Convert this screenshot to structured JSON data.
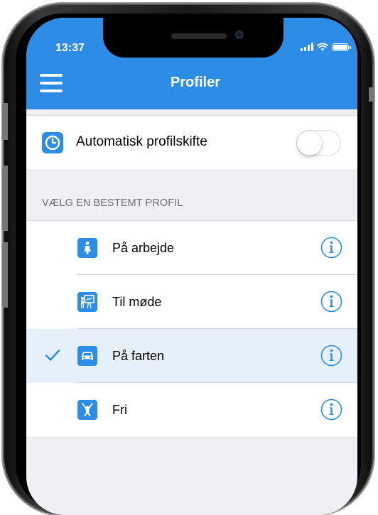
{
  "status_bar": {
    "time": "13:37"
  },
  "header": {
    "title": "Profiler",
    "menu_icon": "hamburger-menu-icon"
  },
  "auto_switch": {
    "label": "Automatisk profilskifte",
    "icon": "clock-icon",
    "enabled": false
  },
  "section": {
    "title": "VÆLG EN BESTEMT PROFIL"
  },
  "profiles": [
    {
      "label": "På arbejde",
      "icon": "worker-icon",
      "selected": false
    },
    {
      "label": "Til møde",
      "icon": "presentation-icon",
      "selected": false
    },
    {
      "label": "På farten",
      "icon": "car-icon",
      "selected": true
    },
    {
      "label": "Fri",
      "icon": "jumping-person-icon",
      "selected": false
    }
  ],
  "colors": {
    "accent": "#2d8ce6",
    "selected_row": "#e6f0fb",
    "background": "#efeff4"
  }
}
